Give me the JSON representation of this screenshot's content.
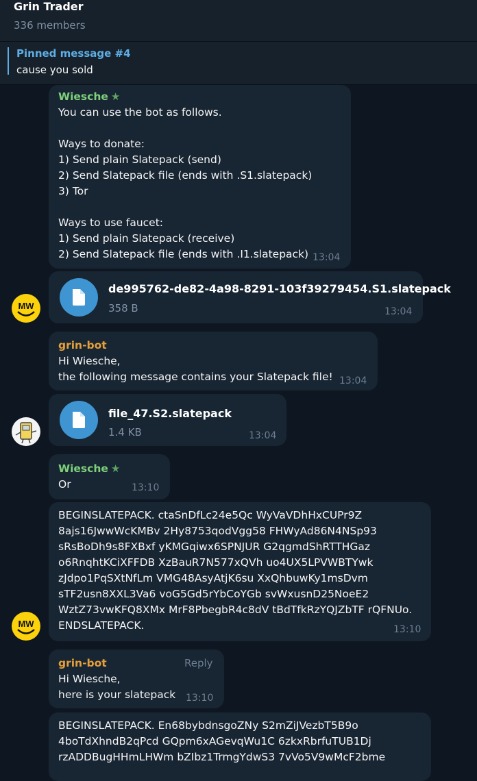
{
  "header": {
    "title": "Grin Trader",
    "subtitle": "336 members"
  },
  "pinned": {
    "title": "Pinned message #4",
    "text": "cause you sold"
  },
  "messages": {
    "m1": {
      "sender": "Wiesche",
      "lines": [
        "You can use the bot as follows.",
        "",
        "Ways to donate:",
        "1) Send plain Slatepack (send)",
        "2) Send Slatepack file (ends with .S1.slatepack)",
        "3) Tor",
        "",
        "Ways to use faucet:",
        "1) Send plain Slatepack (receive)",
        "2) Send Slatepack file (ends with .I1.slatepack)"
      ],
      "time": "13:04"
    },
    "m2": {
      "file_name": "de995762-de82-4a98-8291-103f39279454.S1.slatepack",
      "file_size": "358 B",
      "time": "13:04"
    },
    "m3": {
      "sender": "grin-bot",
      "line1": "Hi Wiesche,",
      "line2": "the following message contains your Slatepack file!",
      "time": "13:04"
    },
    "m4": {
      "file_name": "file_47.S2.slatepack",
      "file_size": "1.4 KB",
      "time": "13:04"
    },
    "m5": {
      "sender": "Wiesche",
      "text": "Or",
      "time": "13:10"
    },
    "m6": {
      "lines": [
        "BEGINSLATEPACK. ctaSnDfLc24e5Qc WyVaVDhHxCUPr9Z",
        "8ajs16JwwWcKMBv 2Hy8753qodVgg58 FHWyAd86N4NSp93",
        "sRsBoDh9s8FXBxf yKMGqiwx6SPNJUR G2qgmdShRTTHGaz",
        "o6RnqhtKCiXFFDB XzBauR7N577xQVh uo4UX5LPVWBTYwk",
        "zJdpo1PqSXtNfLm VMG48AsyAtjK6su XxQhbuwKy1msDvm",
        "sTF2usn8XXL3Va6 voG5Gd5rYbCoYGb svWxusnD25NoeE2",
        "WztZ73vwKFQ8XMx MrF8PbegbR4c8dV tBdTfkRzYQJZbTF rQFNUo.",
        "ENDSLATEPACK."
      ],
      "time": "13:10"
    },
    "m7": {
      "sender": "grin-bot",
      "reply_label": "Reply",
      "line1": "Hi Wiesche,",
      "line2": "here is your slatepack",
      "time": "13:10"
    },
    "m8": {
      "lines": [
        "BEGINSLATEPACK. En68bybdnsgoZNy S2mZiJVezbT5B9o",
        "4boTdXhndB2qPcd GQpm6xAGevqWu1C 6zkxRbrfuTUB1Dj",
        "rzADDBugHHmLHWm bZIbz1TrmgYdwS3 7vVo5V9wMcF2bme"
      ]
    }
  },
  "colors": {
    "background": "#0e1621",
    "bubble": "#182533",
    "accent": "#5eaee5",
    "sender_green": "#7ed07a",
    "sender_orange": "#e6a03a"
  },
  "icons": {
    "file": "document-icon",
    "star": "star-icon",
    "avatar_user": "mw-smiley-avatar",
    "avatar_bot": "robot-avatar"
  }
}
